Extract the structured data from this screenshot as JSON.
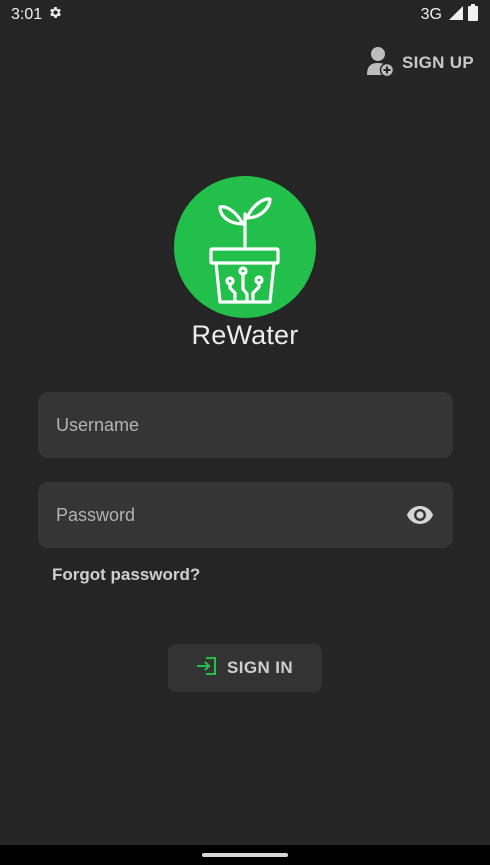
{
  "status": {
    "time": "3:01",
    "network": "3G",
    "icons": [
      "settings-gear-icon",
      "signal-icon",
      "battery-icon"
    ]
  },
  "header": {
    "signup_label": "SIGN UP",
    "signup_icon": "add-user-icon"
  },
  "app": {
    "name": "ReWater",
    "logo_icon": "plant-pot-circuit-icon",
    "brand_color": "#22c04b"
  },
  "form": {
    "username_placeholder": "Username",
    "username_value": "",
    "password_placeholder": "Password",
    "password_value": "",
    "password_toggle_icon": "eye-icon",
    "forgot_label": "Forgot password?",
    "signin_label": "SIGN IN",
    "signin_icon": "login-arrow-icon"
  },
  "colors": {
    "background": "#252525",
    "field_background": "#353535",
    "accent": "#22c04b"
  }
}
